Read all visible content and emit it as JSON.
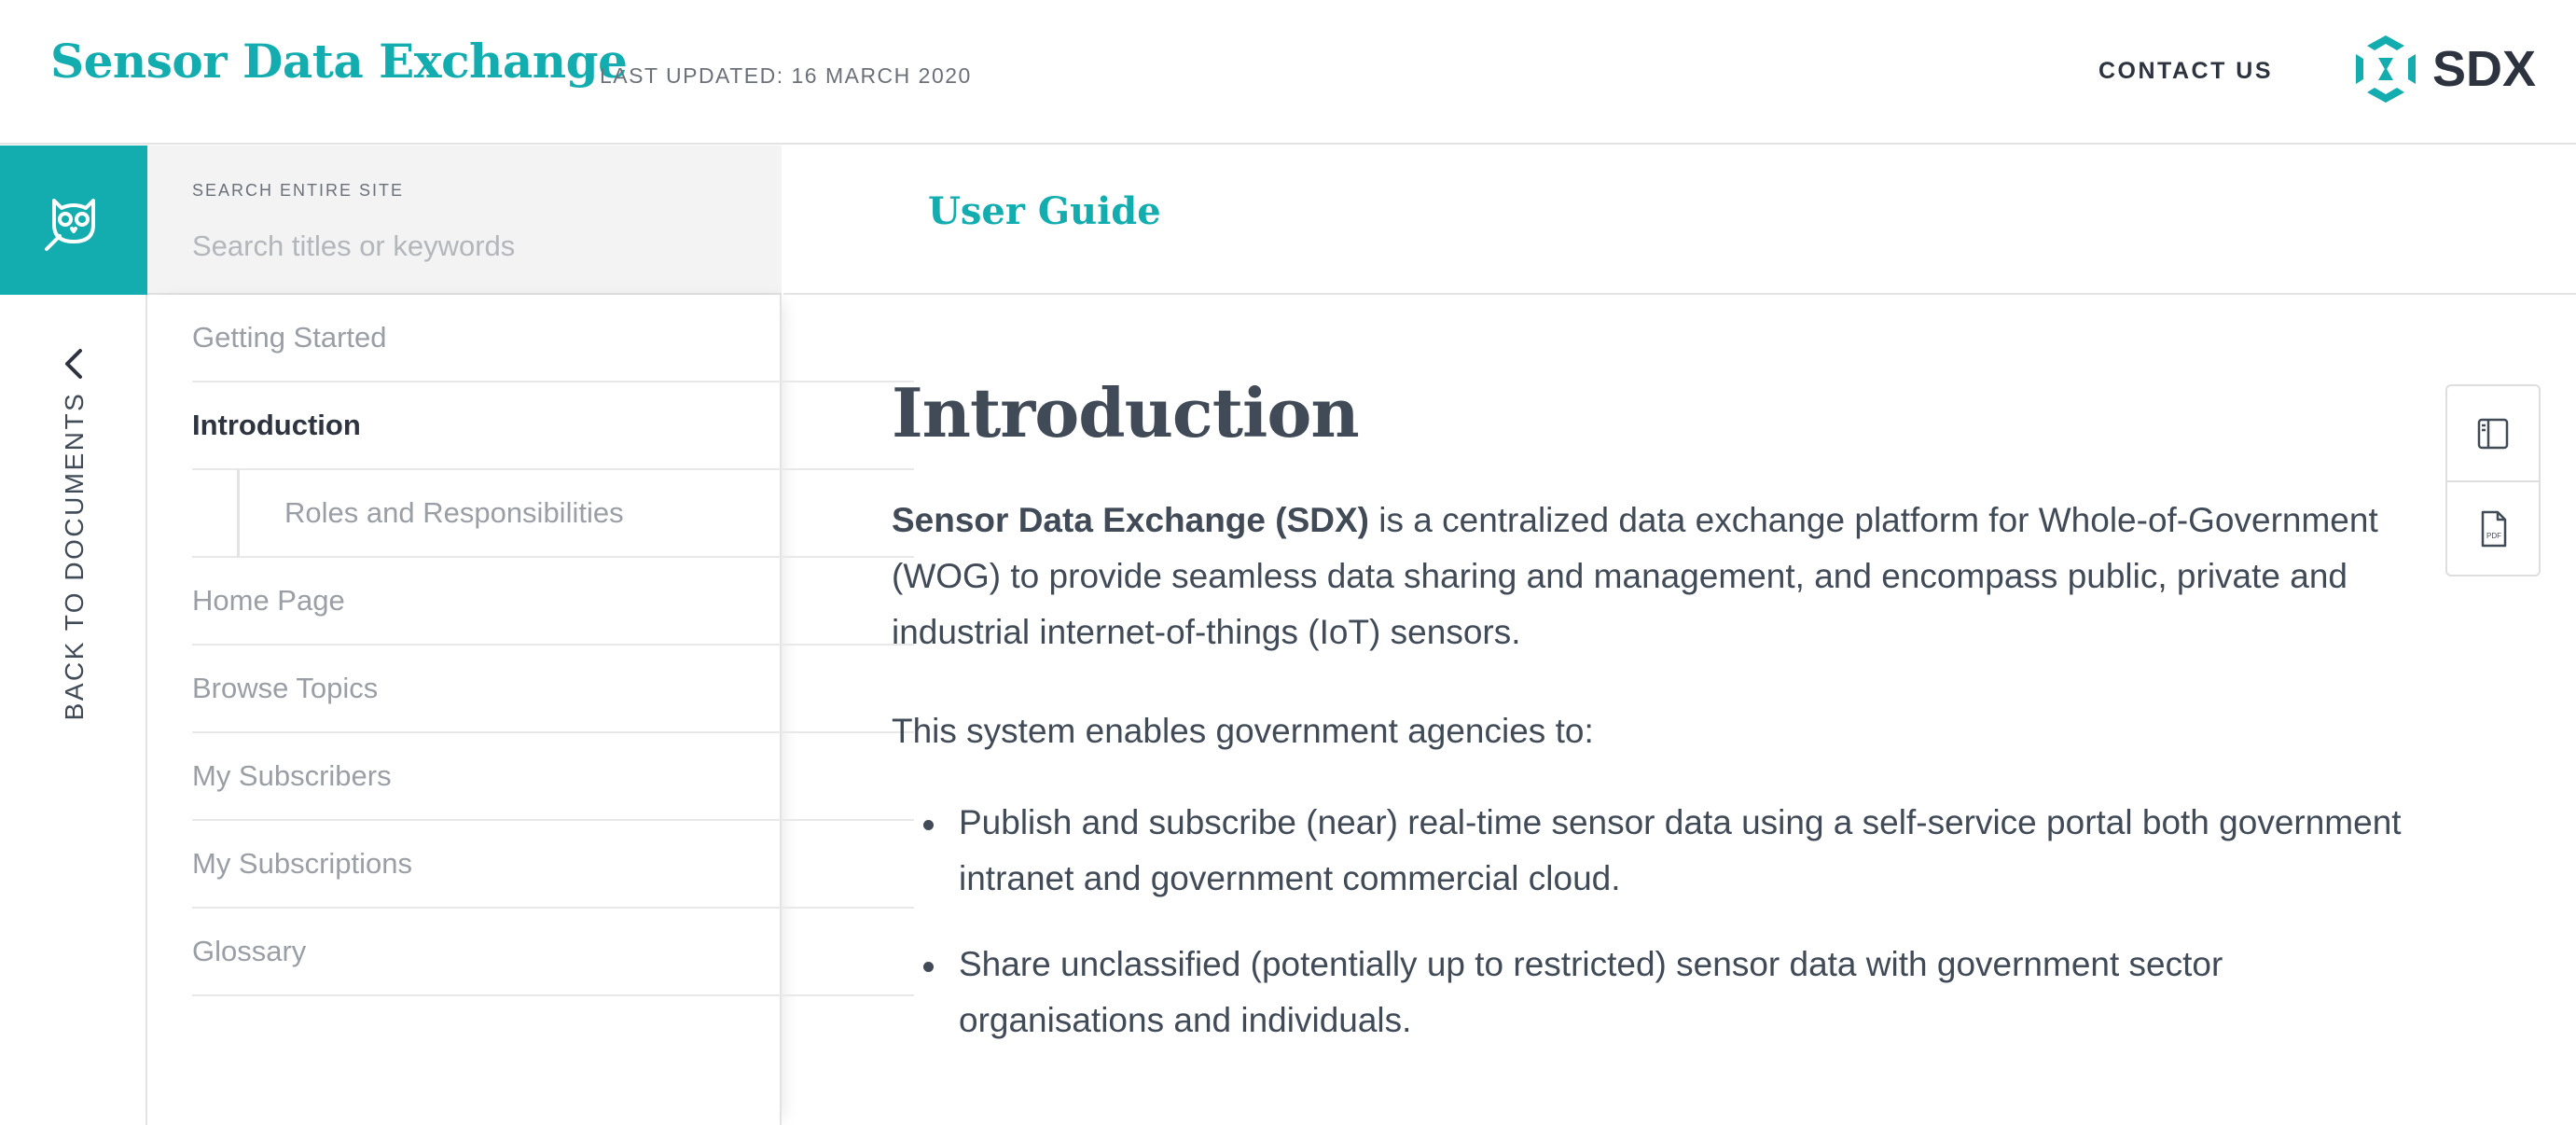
{
  "header": {
    "site_title": "Sensor Data Exchange",
    "last_updated": "LAST UPDATED: 16 MARCH 2020",
    "contact_label": "CONTACT US",
    "brand_text": "SDX",
    "brand_icon": "sdx-hexagon-logo",
    "accent_color": "#13adb0"
  },
  "left_rail": {
    "owl_icon": "owl-search-icon",
    "back_label": "BACK TO DOCUMENTS",
    "back_icon": "chevron-left-icon"
  },
  "search": {
    "caption": "SEARCH ENTIRE SITE",
    "placeholder": "Search titles or keywords",
    "value": ""
  },
  "nav": {
    "items": [
      {
        "label": "Getting Started",
        "active": false
      },
      {
        "label": "Introduction",
        "active": true
      },
      {
        "label": "Roles and Responsibilities",
        "active": false,
        "sub": true
      },
      {
        "label": "Home Page",
        "active": false
      },
      {
        "label": "Browse Topics",
        "active": false
      },
      {
        "label": "My Subscribers",
        "active": false
      },
      {
        "label": "My Subscriptions",
        "active": false
      },
      {
        "label": "Glossary",
        "active": false
      }
    ]
  },
  "main": {
    "guide_title": "User Guide",
    "heading": "Introduction",
    "intro_bold": "Sensor Data Exchange (SDX)",
    "intro_rest": " is a centralized data exchange platform for Whole-of-Government (WOG) to provide seamless data sharing and management, and encompass public, private and industrial internet-of-things (IoT) sensors.",
    "second_paragraph": "This system enables government agencies to:",
    "bullets": [
      "Publish and subscribe (near) real-time sensor data using a self-service portal both government intranet and government commercial cloud.",
      "Share unclassified (potentially up to restricted) sensor data with government sector organisations and individuals."
    ]
  },
  "tools": {
    "sidebar_toggle_icon": "sidebar-toggle-icon",
    "pdf_icon": "pdf-file-icon",
    "pdf_badge": "PDF"
  }
}
